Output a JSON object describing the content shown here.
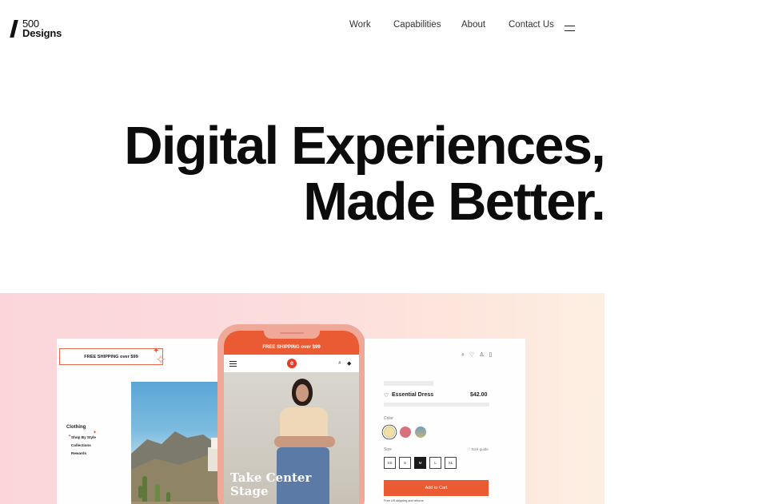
{
  "header": {
    "logo_line1": "500",
    "logo_line2": "Designs",
    "nav": [
      "Work",
      "Capabilities",
      "About",
      "Contact Us"
    ]
  },
  "hero": {
    "line1": "Digital Experiences,",
    "line2": "Made Better."
  },
  "showcase": {
    "left_card": {
      "shipping_text": "FREE SHIPPING over $99",
      "menu_title": "Clothing",
      "menu_items": [
        "Shop By Style",
        "Collections",
        "Rewards"
      ]
    },
    "phone": {
      "shipping_text": "FREE SHIPPING over $99",
      "logo_glyph": "e",
      "hero_text_line1": "Take Center",
      "hero_text_line2": "Stage"
    },
    "product_card": {
      "product_name": "Essential Dress",
      "price": "$42.00",
      "color_label": "Color",
      "size_label": "Size",
      "size_guide": "♡ Size guide",
      "sizes": [
        "XS",
        "S",
        "M",
        "L",
        "XL"
      ],
      "selected_size": "M",
      "add_to_cart": "Add to Cart",
      "free_shipping_note": "Free US shipping and returns"
    },
    "colors": {
      "accent": "#ea5a33",
      "swatch_1": "#f1e1a9",
      "swatch_2": "#d9707a",
      "swatch_3": "#6e9dc4"
    }
  }
}
